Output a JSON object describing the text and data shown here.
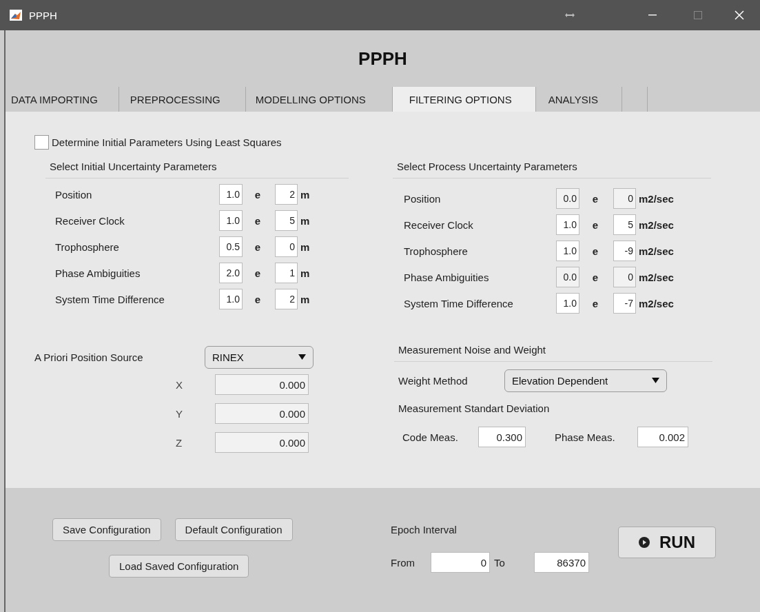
{
  "window": {
    "title": "PPPH"
  },
  "header": "PPPH",
  "tabs": [
    {
      "label": "DATA IMPORTING",
      "selected": false
    },
    {
      "label": "PREPROCESSING",
      "selected": false
    },
    {
      "label": "MODELLING OPTIONS",
      "selected": false
    },
    {
      "label": "FILTERING OPTIONS",
      "selected": true
    },
    {
      "label": "ANALYSIS",
      "selected": false
    }
  ],
  "least_squares": {
    "label": "Determine Initial Parameters Using Least Squares",
    "checked": false
  },
  "initial_uncertainty": {
    "title": "Select Initial Uncertainty Parameters",
    "rows": [
      {
        "label": "Position",
        "mantissa": "1.0",
        "separator": "e",
        "exponent": "2",
        "unit": "m",
        "disabled": false
      },
      {
        "label": "Receiver Clock",
        "mantissa": "1.0",
        "separator": "e",
        "exponent": "5",
        "unit": "m",
        "disabled": false
      },
      {
        "label": "Trophosphere",
        "mantissa": "0.5",
        "separator": "e",
        "exponent": "0",
        "unit": "m",
        "disabled": false
      },
      {
        "label": "Phase Ambiguities",
        "mantissa": "2.0",
        "separator": "e",
        "exponent": "1",
        "unit": "m",
        "disabled": false
      },
      {
        "label": "System Time Difference",
        "mantissa": "1.0",
        "separator": "e",
        "exponent": "2",
        "unit": "m",
        "disabled": false
      }
    ]
  },
  "process_uncertainty": {
    "title": "Select Process Uncertainty Parameters",
    "rows": [
      {
        "label": "Position",
        "mantissa": "0.0",
        "separator": "e",
        "exponent": "0",
        "unit": "m2/sec",
        "disabled": true
      },
      {
        "label": "Receiver Clock",
        "mantissa": "1.0",
        "separator": "e",
        "exponent": "5",
        "unit": "m2/sec",
        "disabled": false
      },
      {
        "label": "Trophosphere",
        "mantissa": "1.0",
        "separator": "e",
        "exponent": "-9",
        "unit": "m2/sec",
        "disabled": false
      },
      {
        "label": "Phase Ambiguities",
        "mantissa": "0.0",
        "separator": "e",
        "exponent": "0",
        "unit": "m2/sec",
        "disabled": true
      },
      {
        "label": "System Time Difference",
        "mantissa": "1.0",
        "separator": "e",
        "exponent": "-7",
        "unit": "m2/sec",
        "disabled": false
      }
    ]
  },
  "a_priori": {
    "label": "A Priori Position Source",
    "source": "RINEX",
    "coordinates": [
      {
        "axis": "X",
        "value": "0.000",
        "disabled": true
      },
      {
        "axis": "Y",
        "value": "0.000",
        "disabled": true
      },
      {
        "axis": "Z",
        "value": "0.000",
        "disabled": true
      }
    ]
  },
  "measurement": {
    "title": "Measurement Noise and Weight",
    "weight_label": "Weight Method",
    "weight_method": "Elevation Dependent",
    "std_title": "Measurement Standart Deviation",
    "code_label": "Code Meas.",
    "code_value": "0.300",
    "phase_label": "Phase Meas.",
    "phase_value": "0.002"
  },
  "configuration_buttons": [
    "Save Configuration",
    "Default Configuration",
    "Load Saved Configuration"
  ],
  "epoch": {
    "title": "Epoch Interval",
    "from_label": "From",
    "from": "0",
    "to_label": "To",
    "to": "86370"
  },
  "run_button": "RUN"
}
